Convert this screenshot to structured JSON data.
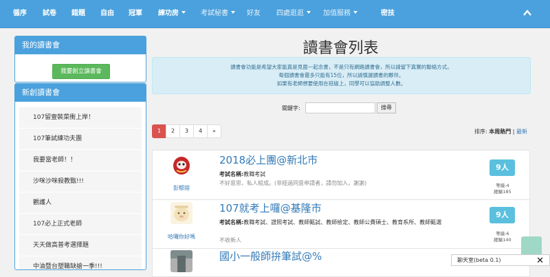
{
  "nav": {
    "items": [
      {
        "label": "循序",
        "dropdown": false
      },
      {
        "label": "試卷",
        "dropdown": false
      },
      {
        "label": "錯題",
        "dropdown": false
      },
      {
        "label": "自由",
        "dropdown": false
      },
      {
        "label": "冠軍",
        "dropdown": false
      },
      {
        "label": "練功房",
        "dropdown": true
      },
      {
        "label": "考試秘書",
        "dropdown": true
      },
      {
        "label": "好友",
        "dropdown": false
      },
      {
        "label": "四處逛逛",
        "dropdown": true
      },
      {
        "label": "加值服務",
        "dropdown": true
      },
      {
        "label": "密技",
        "dropdown": false
      }
    ]
  },
  "sidebar": {
    "my_clubs_title": "我的讀書會",
    "create_button": "我要創立讀書會",
    "new_clubs_title": "新創讀書會",
    "new_clubs": [
      "107留壹裝菜衝上岸！",
      "107筆試練功夫團",
      "我要當老師！！",
      "沙咪沙咪殺教甄!!!",
      "觀護人",
      "107必上正式老師",
      "天天做高普考選擇題",
      "中油暨台塑職缺搶一季!!!"
    ]
  },
  "main": {
    "title": "讀書會列表",
    "info_lines": [
      "讀書會功能是希望大家能真是見面一起念書，不是只有網路讀書會，所以請留下真實的聯絡方式。",
      "每個讀書會最多只能有15位，所以請慎選讀書的夥伴。",
      "如果有老師想要使用在班級上，同學可以協助調整人數。"
    ],
    "keyword_label": "關鍵字:",
    "keyword_value": "",
    "search_button": "搜尋",
    "pages": [
      "1",
      "2",
      "3",
      "4",
      "»"
    ],
    "active_page": "1",
    "sort_label": "排序:",
    "sort_active": "本周熱門",
    "sort_sep": "|",
    "sort_other": "最新"
  },
  "groups": [
    {
      "owner": "彭郁熔",
      "title": "2018必上團@新北市",
      "exam_label": "考試名稱:",
      "exam": "教職考試",
      "note": "不好意思，私人組成。(非經過同意申請者，請勿加入，謝謝)",
      "count": "9人",
      "level": "等級:4",
      "exp": "經驗185"
    },
    {
      "owner": "哈囉你好嗎",
      "title": "107就考上囉@基隆市",
      "exam_label": "考試名稱:",
      "exam": "教職考試、證照考試、教師甄試、教師檢定、教師公費碩士、教育系所、教師甄選",
      "note": "不收新人",
      "count": "9人",
      "level": "等級:6",
      "exp": "經驗140"
    },
    {
      "owner": "",
      "title": "國小一般師拚筆試@%",
      "exam_label": "",
      "exam": "",
      "note": "",
      "count": "",
      "level": "",
      "exp": ""
    }
  ],
  "chat": {
    "label": "聊天室(beta 0.1)",
    "close": "✕"
  }
}
